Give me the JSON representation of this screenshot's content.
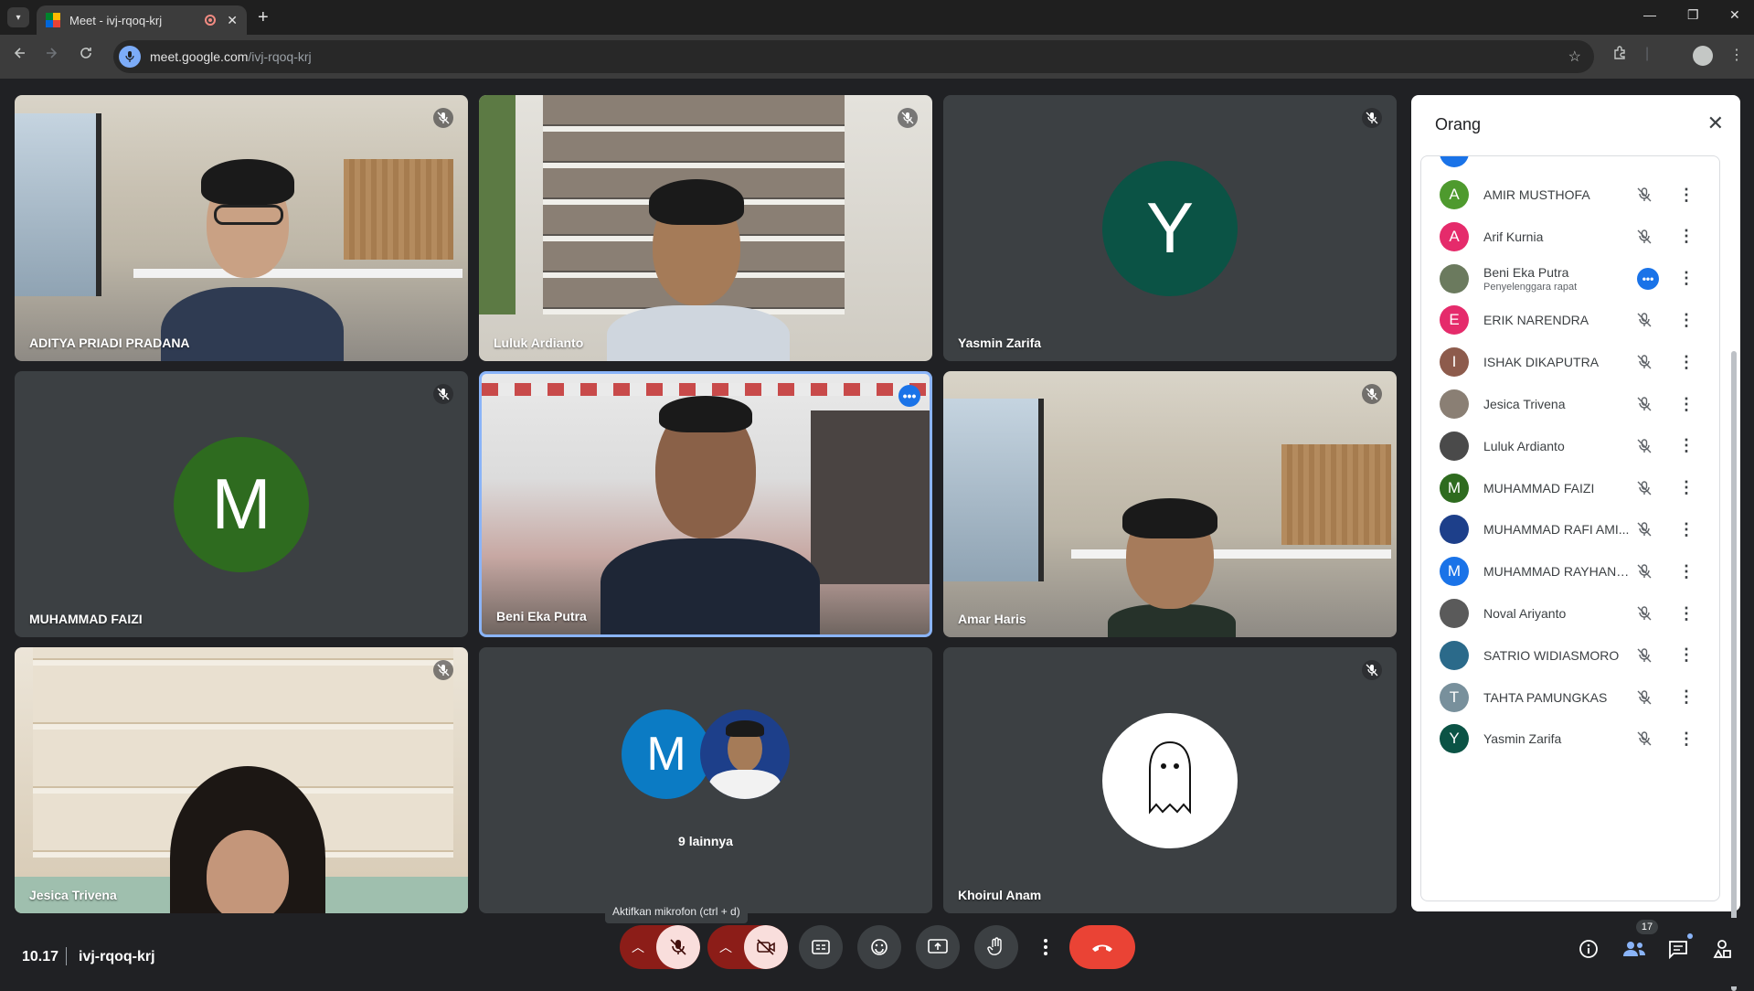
{
  "browser": {
    "tab_title": "Meet - ivj-rqoq-krj",
    "url_host": "meet.google.com",
    "url_path": "/ivj-rqoq-krj",
    "new_tab": "+",
    "tab_close": "✕",
    "minimize": "—",
    "restore": "❐",
    "close": "✕"
  },
  "tiles": [
    {
      "name": "ADITYA PRIADI PRADANA"
    },
    {
      "name": "Luluk Ardianto"
    },
    {
      "name": "Yasmin Zarifa",
      "initial": "Y",
      "color": "#0b5345"
    },
    {
      "name": "MUHAMMAD FAIZI",
      "initial": "M",
      "color": "#2e6b1f"
    },
    {
      "name": "Beni Eka Putra"
    },
    {
      "name": "Amar Haris"
    },
    {
      "name": "Jesica Trivena"
    },
    {
      "name": "9 lainnya",
      "initial": "M",
      "color": "#0b7bc4"
    },
    {
      "name": "Khoirul Anam"
    }
  ],
  "people_panel": {
    "title": "Orang",
    "participants": [
      {
        "name": "AMIR MUSTHOFA",
        "initial": "A",
        "color": "#4e9a2e"
      },
      {
        "name": "Arif Kurnia",
        "initial": "A",
        "color": "#e52b6b"
      },
      {
        "name": "Beni Eka Putra",
        "subtitle": "Penyelenggara rapat",
        "initial": "",
        "color": "#6b7a5e"
      },
      {
        "name": "ERIK NARENDRA",
        "initial": "E",
        "color": "#e52b6b"
      },
      {
        "name": "ISHAK DIKAPUTRA",
        "initial": "I",
        "color": "#8d5b4c"
      },
      {
        "name": "Jesica Trivena",
        "initial": "",
        "color": "#8a7f74"
      },
      {
        "name": "Luluk Ardianto",
        "initial": "",
        "color": "#4a4a4a"
      },
      {
        "name": "MUHAMMAD FAIZI",
        "initial": "M",
        "color": "#2e6b1f"
      },
      {
        "name": "MUHAMMAD RAFI AMI...",
        "initial": "",
        "color": "#1d3f8a"
      },
      {
        "name": "MUHAMMAD RAYHAN ...",
        "initial": "M",
        "color": "#1a73e8"
      },
      {
        "name": "Noval Ariyanto",
        "initial": "",
        "color": "#5a5a5a"
      },
      {
        "name": "SATRIO WIDIASMORO",
        "initial": "",
        "color": "#2b6a8a"
      },
      {
        "name": "TAHTA PAMUNGKAS",
        "initial": "T",
        "color": "#78909c"
      },
      {
        "name": "Yasmin Zarifa",
        "initial": "Y",
        "color": "#0b5345"
      }
    ]
  },
  "bottom_bar": {
    "time": "10.17",
    "meeting_code": "ivj-rqoq-krj",
    "mic_tooltip": "Aktifkan mikrofon (ctrl + d)",
    "people_count": "17"
  },
  "colors": {
    "accent": "#8ab4f8",
    "end_call": "#ea4335",
    "muted_bg": "#8c1d18"
  }
}
